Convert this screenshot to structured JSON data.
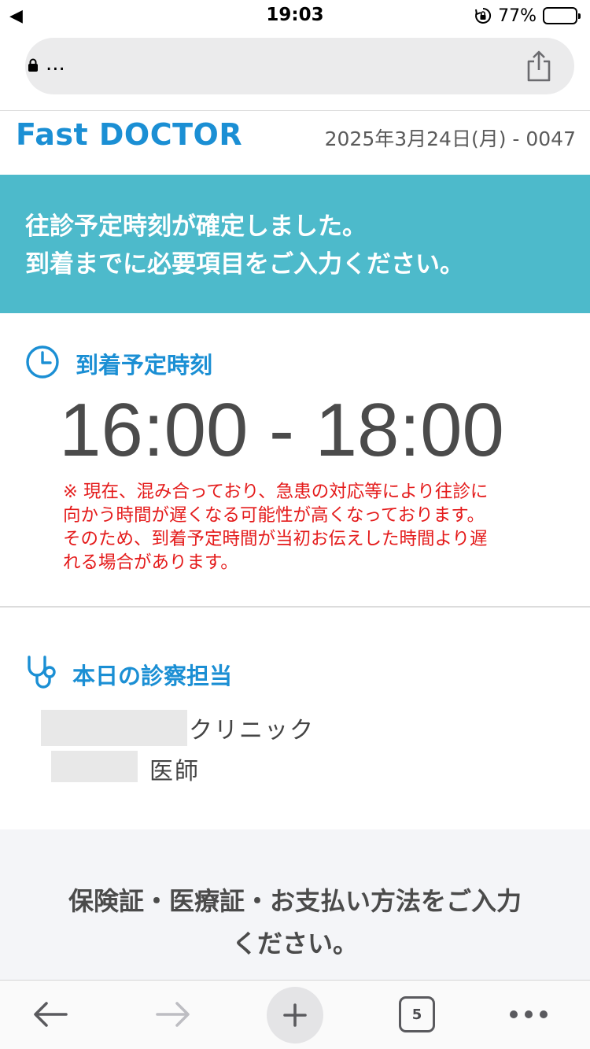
{
  "status_bar": {
    "back_glyph": "◀",
    "time": "19:03",
    "battery_percent": "77%",
    "battery_level": 0.77
  },
  "url_bar": {
    "url_text": "..."
  },
  "header": {
    "brand": "Fast DOCTOR",
    "date_id": "2025年3月24日(月) - 0047"
  },
  "banner": {
    "line1": "往診予定時刻が確定しました。",
    "line2": "到着までに必要項目をご入力ください。"
  },
  "arrival": {
    "title": "到着予定時刻",
    "time_range": "16:00 - 18:00",
    "notice_lines": [
      "※ 現在、混み合っており、急患の対応等により往診に",
      "向かう時間が遅くなる可能性が高くなっております。",
      "そのため、到着予定時間が当初お伝えした時間より遅",
      "れる場合があります。"
    ]
  },
  "doctor": {
    "title": "本日の診察担当",
    "clinic_suffix": "クリニック",
    "doctor_suffix": "医師"
  },
  "insurance": {
    "line1": "保険証・医療証・お支払い方法をご入力",
    "line2": "ください。"
  },
  "toolbar": {
    "tab_count": "5"
  },
  "colors": {
    "brand_blue": "#1b8fd4",
    "banner_teal": "#4dbacb",
    "notice_red": "#e41b1b"
  },
  "icons": [
    "lock-icon",
    "share-icon",
    "clock-icon",
    "stethoscope-icon",
    "back-arrow-icon",
    "forward-arrow-icon",
    "plus-icon",
    "tabs-icon",
    "more-icon"
  ]
}
